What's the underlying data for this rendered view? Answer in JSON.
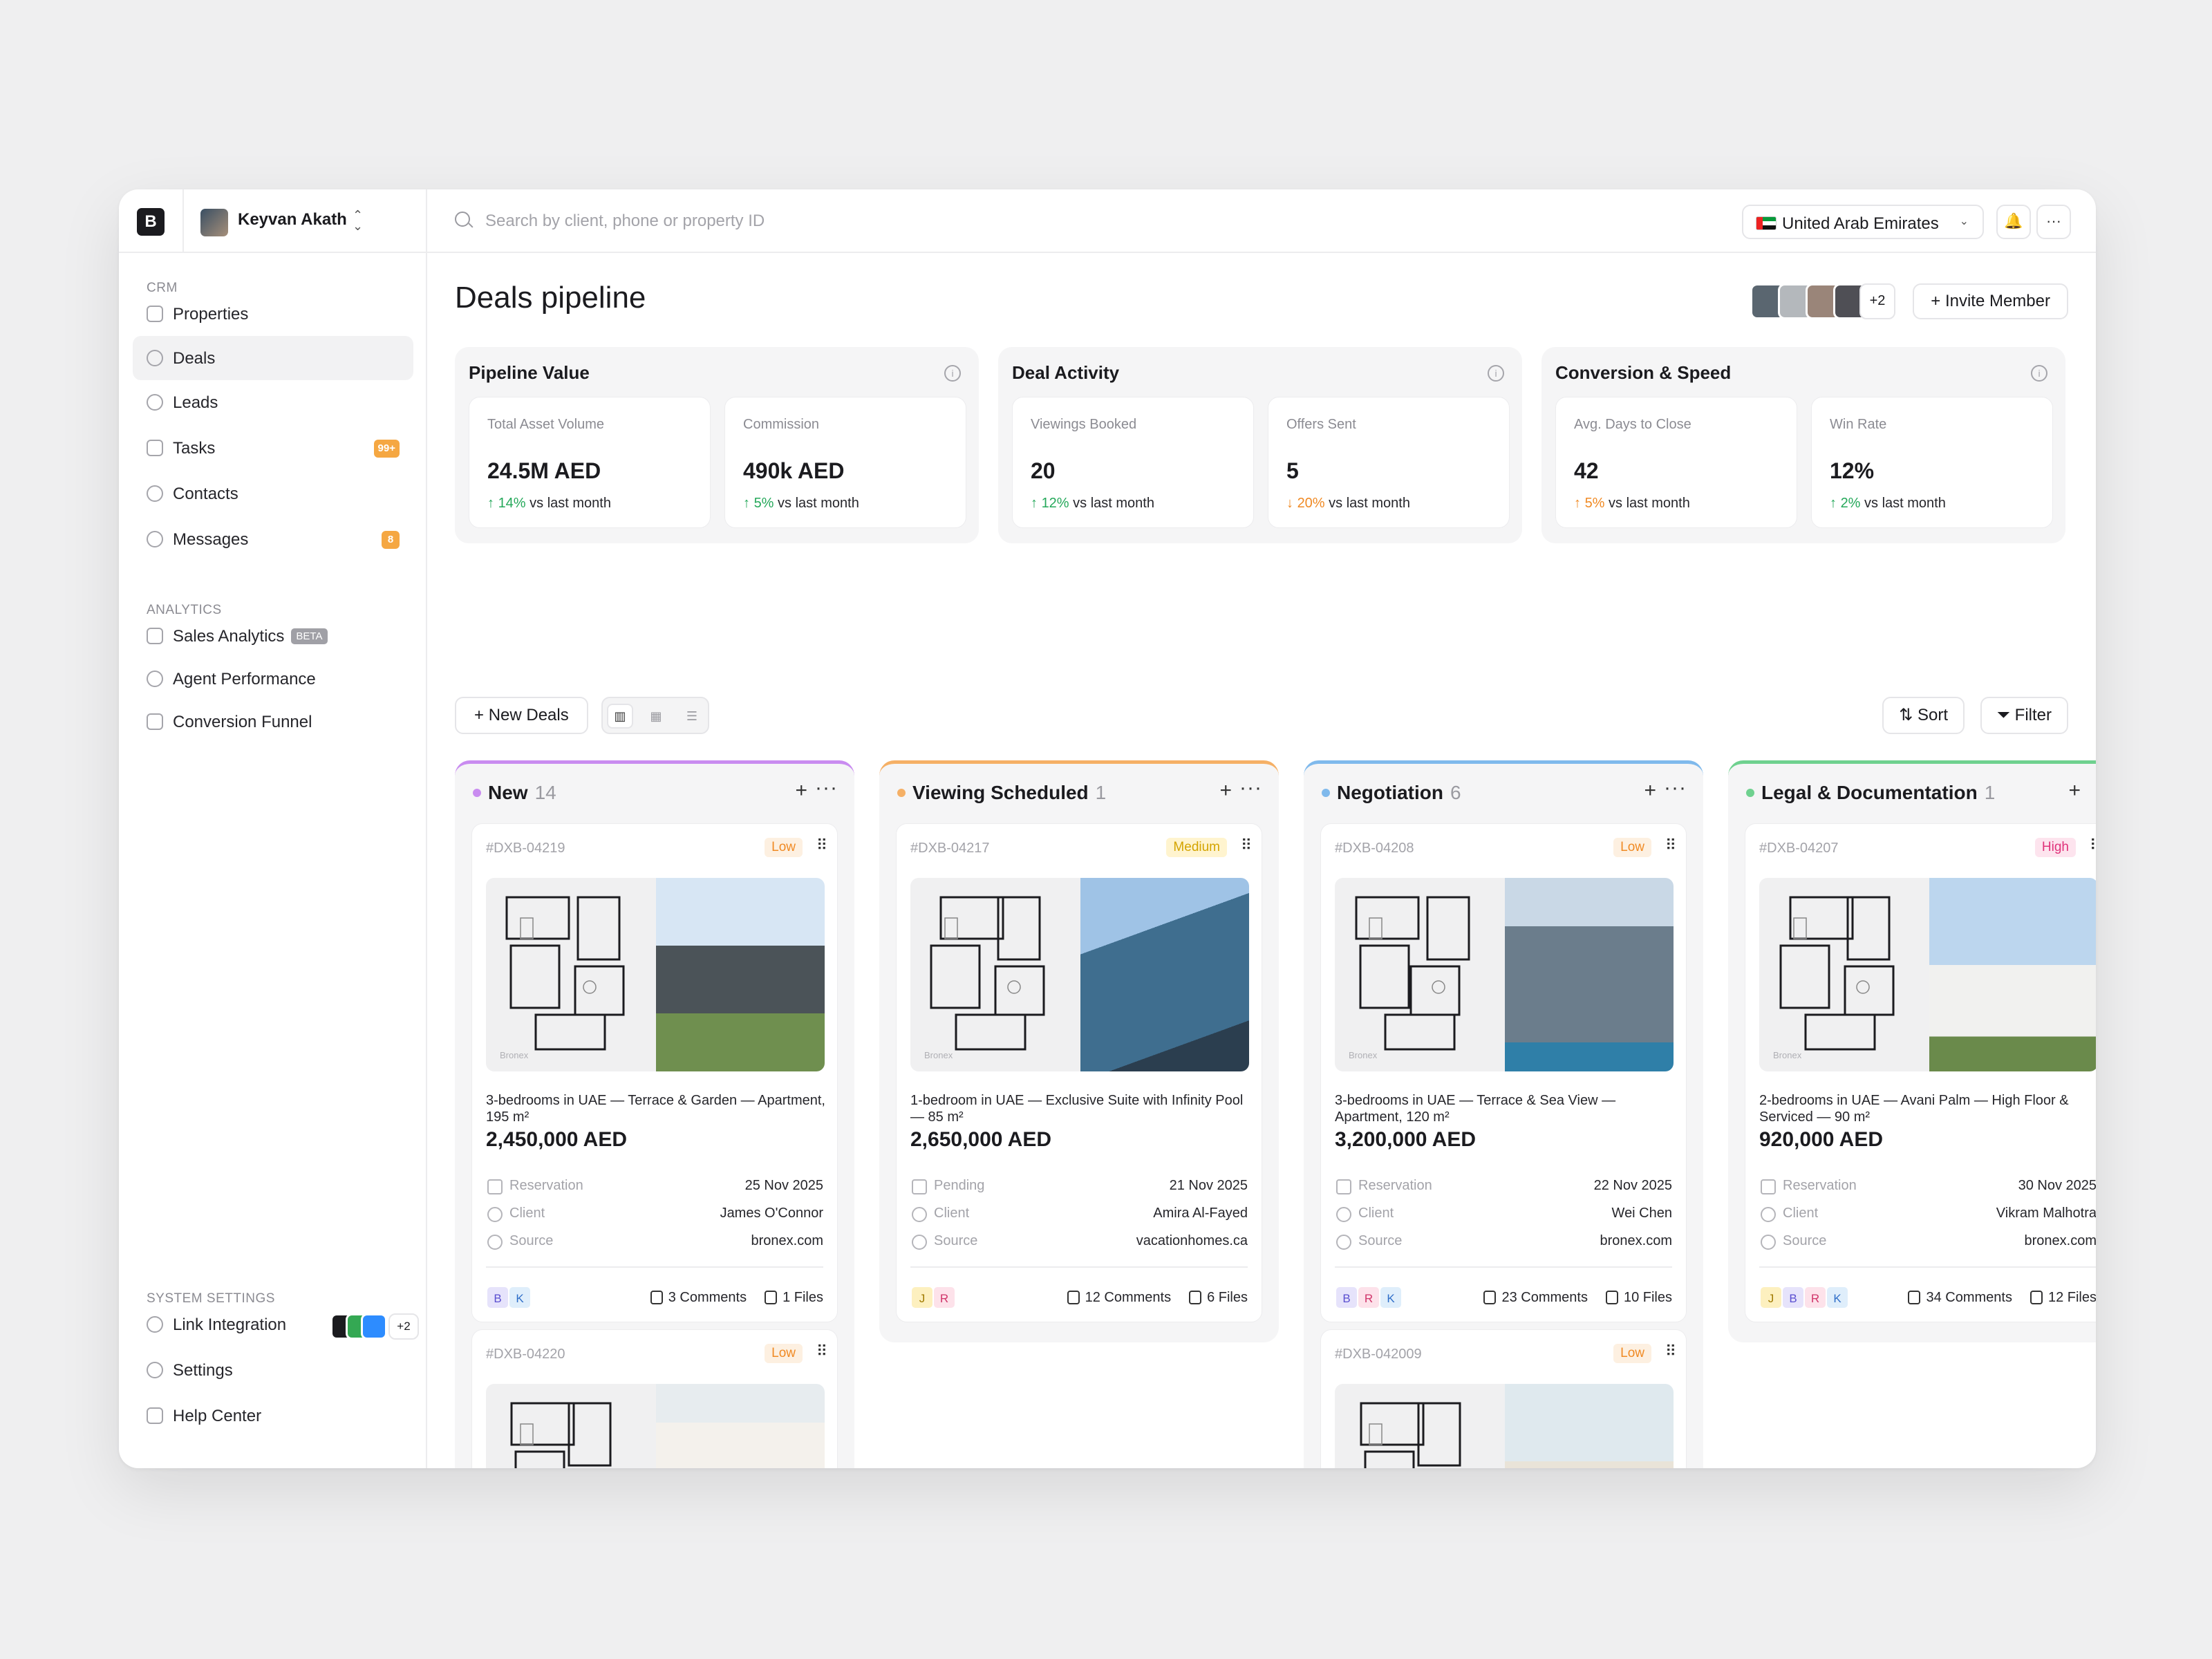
{
  "app": {
    "logo": "B",
    "user": "Keyvan Akath"
  },
  "sidebar": {
    "crm_label": "CRM",
    "crm_items": [
      {
        "label": "Properties",
        "icon": "home-icon"
      },
      {
        "label": "Deals",
        "icon": "dollar-icon",
        "active": true
      },
      {
        "label": "Leads",
        "icon": "users-icon"
      },
      {
        "label": "Tasks",
        "icon": "clipboard-icon",
        "badge": "99+"
      },
      {
        "label": "Contacts",
        "icon": "contact-icon"
      },
      {
        "label": "Messages",
        "icon": "chat-icon",
        "badge": "8"
      }
    ],
    "analytics_label": "ANALYTICS",
    "analytics_items": [
      {
        "label": "Sales Analytics",
        "icon": "chart-icon",
        "tag": "BETA"
      },
      {
        "label": "Agent Performance",
        "icon": "target-icon"
      },
      {
        "label": "Conversion Funnel",
        "icon": "funnel-icon"
      }
    ],
    "settings_label": "SYSTEM SETTINGS",
    "settings_items": [
      {
        "label": "Link Integration",
        "icon": "link-icon",
        "more": "+2"
      },
      {
        "label": "Settings",
        "icon": "gear-icon"
      },
      {
        "label": "Help Center",
        "icon": "help-icon"
      }
    ]
  },
  "topbar": {
    "search_placeholder": "Search by client, phone or property ID",
    "country": "United Arab Emirates"
  },
  "page": {
    "title": "Deals pipeline",
    "team_more": "+2",
    "invite": "Invite Member"
  },
  "metrics": [
    {
      "title": "Pipeline Value",
      "stats": [
        {
          "label": "Total Asset Volume",
          "value": "24.5M AED",
          "delta": "14%",
          "dir": "up",
          "suffix": "vs last month"
        },
        {
          "label": "Commission",
          "value": "490k AED",
          "delta": "5%",
          "dir": "up",
          "suffix": "vs last month"
        }
      ]
    },
    {
      "title": "Deal Activity",
      "stats": [
        {
          "label": "Viewings Booked",
          "value": "20",
          "delta": "12%",
          "dir": "up",
          "suffix": "vs last month"
        },
        {
          "label": "Offers Sent",
          "value": "5",
          "delta": "20%",
          "dir": "down",
          "suffix": "vs last month"
        }
      ]
    },
    {
      "title": "Conversion & Speed",
      "stats": [
        {
          "label": "Avg. Days to Close",
          "value": "42",
          "delta": "5%",
          "dir": "up-warn",
          "suffix": "vs last month"
        },
        {
          "label": "Win Rate",
          "value": "12%",
          "delta": "2%",
          "dir": "up",
          "suffix": "vs last month"
        }
      ]
    }
  ],
  "toolbar": {
    "new_deals": "New Deals",
    "sort": "Sort",
    "filter": "Filter"
  },
  "colors": {
    "new": "#c98cf0",
    "viewing": "#f5b066",
    "negotiation": "#7fb9ec",
    "legal": "#6fd18f"
  },
  "columns": [
    {
      "name": "New",
      "count": "14",
      "color": "#c98cf0",
      "deals": [
        {
          "id": "#DXB-04219",
          "priority": "Low",
          "title": "3-bedrooms in UAE — Terrace & Garden — Apartment, 195 m²",
          "price": "2,450,000 AED",
          "status": "Reservation",
          "date": "25 Nov 2025",
          "client_label": "Client",
          "client": "James O'Connor",
          "source_label": "Source",
          "source": "bronex.com",
          "avatars": [
            "B",
            "K"
          ],
          "comments": "3 Comments",
          "files": "1 Files"
        },
        {
          "id": "#DXB-04220",
          "priority": "Low"
        }
      ]
    },
    {
      "name": "Viewing Scheduled",
      "count": "1",
      "color": "#f5b066",
      "deals": [
        {
          "id": "#DXB-04217",
          "priority": "Medium",
          "title": "1-bedroom in UAE — Exclusive Suite with Infinity Pool — 85 m²",
          "price": "2,650,000 AED",
          "status": "Pending",
          "date": "21 Nov 2025",
          "client_label": "Client",
          "client": "Amira Al-Fayed",
          "source_label": "Source",
          "source": "vacationhomes.ca",
          "avatars": [
            "J",
            "R"
          ],
          "comments": "12 Comments",
          "files": "6 Files"
        }
      ]
    },
    {
      "name": "Negotiation",
      "count": "6",
      "color": "#7fb9ec",
      "deals": [
        {
          "id": "#DXB-04208",
          "priority": "Low",
          "title": "3-bedrooms in UAE — Terrace & Sea View — Apartment, 120 m²",
          "price": "3,200,000 AED",
          "status": "Reservation",
          "date": "22 Nov 2025",
          "client_label": "Client",
          "client": "Wei Chen",
          "source_label": "Source",
          "source": "bronex.com",
          "avatars": [
            "B",
            "R",
            "K"
          ],
          "comments": "23 Comments",
          "files": "10 Files"
        },
        {
          "id": "#DXB-042009",
          "priority": "Low"
        }
      ]
    },
    {
      "name": "Legal & Documentation",
      "count": "1",
      "color": "#6fd18f",
      "deals": [
        {
          "id": "#DXB-04207",
          "priority": "High",
          "title": "2-bedrooms in UAE — Avani Palm — High Floor & Serviced — 90 m²",
          "price": "920,000 AED",
          "status": "Reservation",
          "date": "30 Nov 2025",
          "client_label": "Client",
          "client": "Vikram Malhotra",
          "source_label": "Source",
          "source": "bronex.com",
          "avatars": [
            "J",
            "B",
            "R",
            "K"
          ],
          "comments": "34 Comments",
          "files": "12 Files"
        }
      ]
    }
  ],
  "watermark": "Bronex"
}
